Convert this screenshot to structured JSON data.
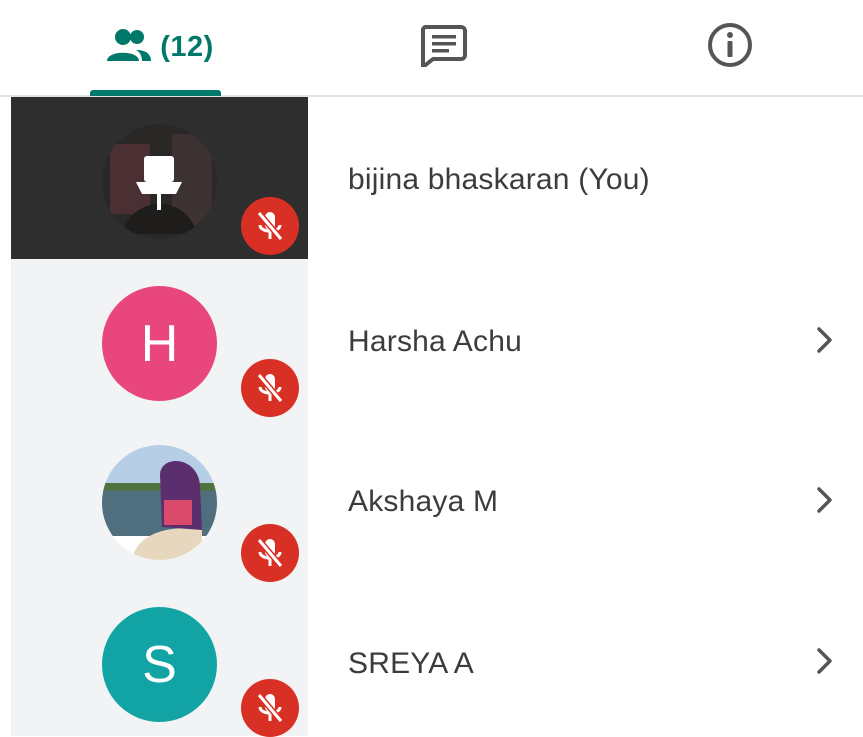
{
  "tabs": {
    "people_icon": "people-icon",
    "people_count": "(12)",
    "chat_icon": "chat-icon",
    "info_icon": "info-icon",
    "active_color": "#00796b"
  },
  "participants": [
    {
      "name": "bijina bhaskaran (You)",
      "avatar_type": "photo",
      "muted": true,
      "selected": true
    },
    {
      "name": "Harsha Achu",
      "avatar_letter": "H",
      "avatar_color": "#e8467c",
      "muted": true
    },
    {
      "name": "Akshaya M",
      "avatar_type": "photo",
      "muted": true
    },
    {
      "name": "SREYA A",
      "avatar_letter": "S",
      "avatar_color": "#12a4a4",
      "muted": true
    }
  ],
  "colors": {
    "mute_badge": "#d93025",
    "selected_row": "#2e2e2e",
    "row_left_bg": "#f1f3f4"
  }
}
